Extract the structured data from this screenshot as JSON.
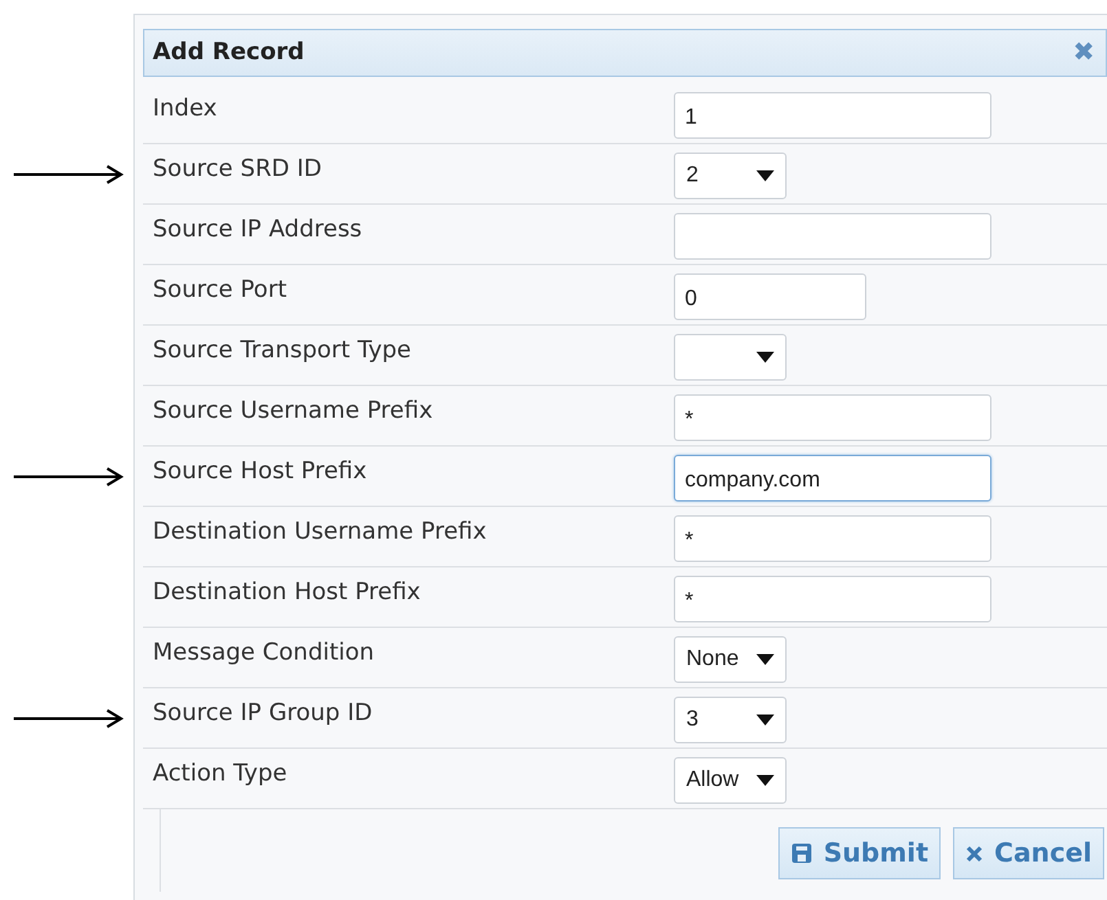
{
  "dialog": {
    "title": "Add Record",
    "close": "✖"
  },
  "fields": [
    {
      "label": "Index",
      "kind": "text",
      "value": "1",
      "marked": false,
      "focused": false
    },
    {
      "label": "Source SRD ID",
      "kind": "select",
      "value": "2",
      "marked": true,
      "focused": false
    },
    {
      "label": "Source IP Address",
      "kind": "text",
      "marked": false,
      "focused": false
    },
    {
      "label": "Source Port",
      "kind": "short",
      "value": "0",
      "marked": false,
      "focused": false
    },
    {
      "label": "Source Transport Type",
      "kind": "select",
      "marked": false,
      "focused": false
    },
    {
      "label": "Source Username Prefix",
      "kind": "text",
      "value": "*",
      "marked": false,
      "focused": false
    },
    {
      "label": "Source Host Prefix",
      "kind": "text",
      "value": "company.com",
      "marked": true,
      "focused": true
    },
    {
      "label": "Destination Username Prefix",
      "kind": "text",
      "value": "*",
      "marked": false,
      "focused": false
    },
    {
      "label": "Destination Host Prefix",
      "kind": "text",
      "value": "*",
      "marked": false,
      "focused": false
    },
    {
      "label": "Message Condition",
      "kind": "select",
      "value": "None",
      "marked": false,
      "focused": false
    },
    {
      "label": "Source IP Group ID",
      "kind": "select",
      "value": "3",
      "marked": true,
      "focused": false
    },
    {
      "label": "Action Type",
      "kind": "select",
      "value": "Allow",
      "marked": false,
      "focused": false
    }
  ],
  "buttons": [
    {
      "label": "Submit",
      "kind": "submit"
    },
    {
      "label": "Cancel",
      "kind": "cancel"
    }
  ]
}
